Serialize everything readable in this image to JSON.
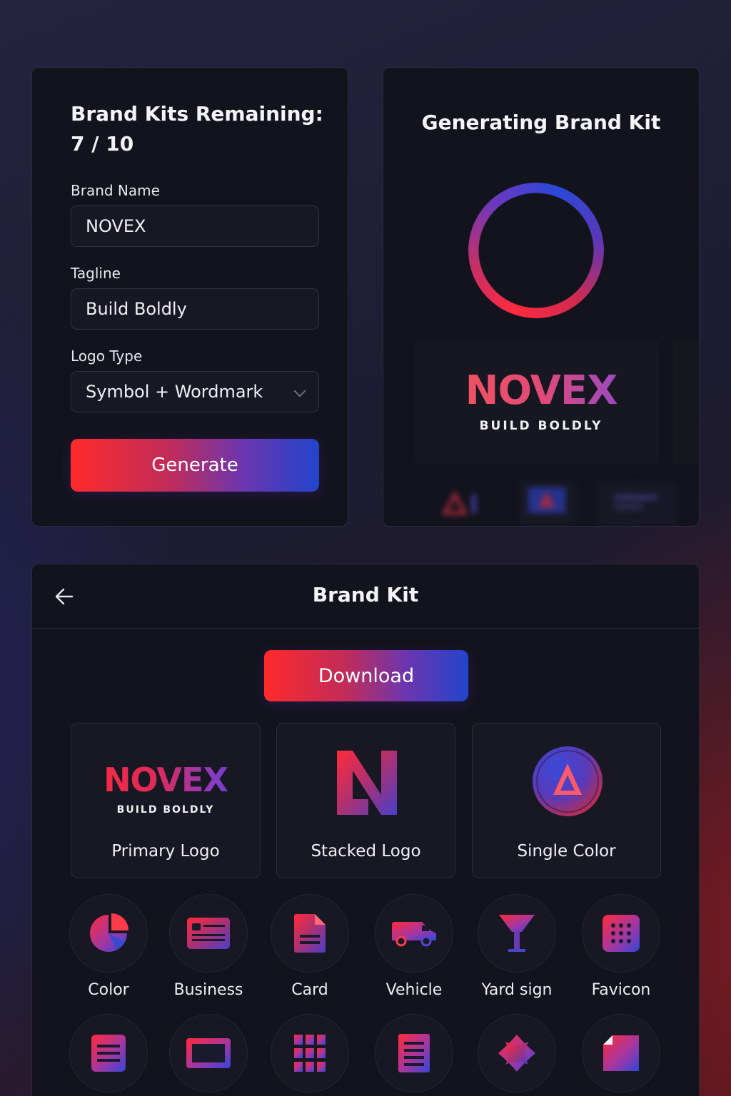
{
  "form": {
    "remaining_label": "Brand Kits Remaining:",
    "remaining_value": "7 / 10",
    "brand_name_label": "Brand Name",
    "brand_name_value": "NOVEX",
    "tagline_label": "Tagline",
    "tagline_value": "Build Boldly",
    "logo_type_label": "Logo Type",
    "logo_type_value": "Symbol + Wordmark",
    "generate_label": "Generate"
  },
  "generating": {
    "title": "Generating Brand Kit",
    "preview_name": "NOVEX",
    "preview_tagline": "BUILD BOLDLY"
  },
  "kit": {
    "title": "Brand Kit",
    "download_label": "Download",
    "logos": [
      {
        "name": "NOVEX",
        "tagline": "BUILD BOLDLY",
        "label": "Primary Logo"
      },
      {
        "label": "Stacked Logo",
        "icon": "n-monogram-icon"
      },
      {
        "label": "Single Color",
        "icon": "a-badge-icon"
      }
    ],
    "assets": [
      {
        "label": "Color",
        "icon": "pie-chart-icon"
      },
      {
        "label": "Business",
        "icon": "business-card-icon"
      },
      {
        "label": "Card",
        "icon": "document-icon"
      },
      {
        "label": "Vehicle",
        "icon": "van-icon"
      },
      {
        "label": "Yard sign",
        "icon": "yard-sign-icon"
      },
      {
        "label": "Favicon",
        "icon": "favicon-grid-icon"
      }
    ],
    "more_assets": [
      "letterhead-icon",
      "banner-icon",
      "grid-icon",
      "flyer-icon",
      "sticker-icon",
      "folded-page-icon"
    ]
  },
  "colors": {
    "gradient_red": "#ff2a2a",
    "gradient_blue": "#2244cc",
    "card_bg": "#13131d"
  }
}
